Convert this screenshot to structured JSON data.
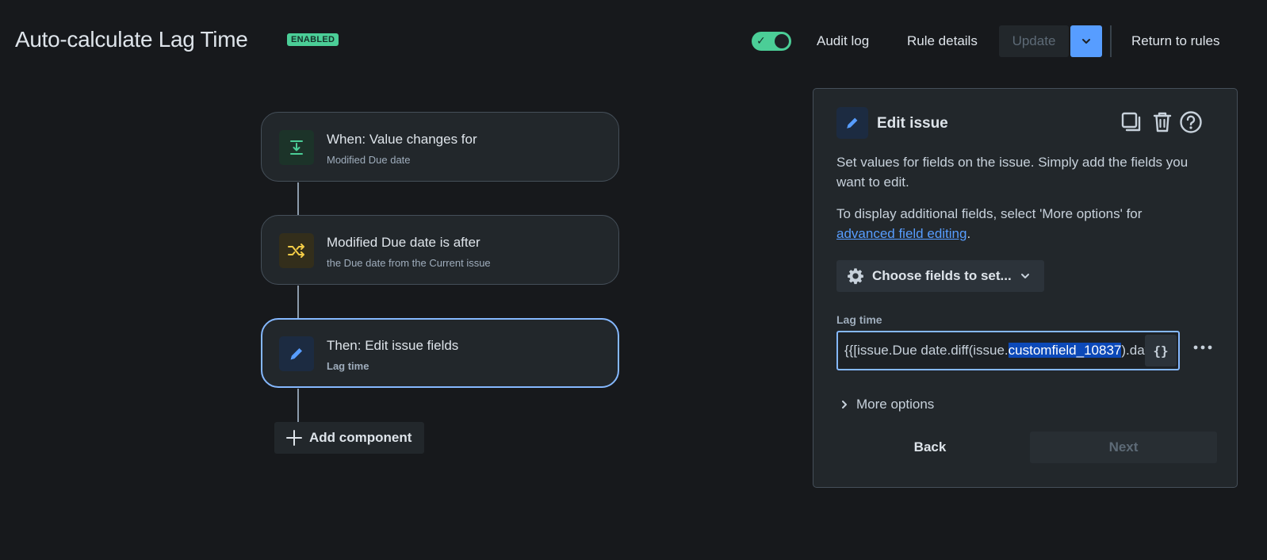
{
  "header": {
    "title": "Auto-calculate Lag Time",
    "status_badge": "ENABLED",
    "audit_log": "Audit log",
    "rule_details": "Rule details",
    "update": "Update",
    "return_to_rules": "Return to rules"
  },
  "flow": {
    "trigger": {
      "title": "When: Value changes for",
      "subtitle": "Modified Due date"
    },
    "condition": {
      "title": "Modified Due date is after",
      "subtitle": "the Due date from the Current issue"
    },
    "action": {
      "title": "Then: Edit issue fields",
      "subtitle": "Lag time"
    },
    "add_component": "Add component"
  },
  "panel": {
    "title": "Edit issue",
    "desc1": "Set values for fields on the issue. Simply add the fields you want to edit.",
    "desc2_prefix": "To display additional fields, select 'More options' for",
    "desc2_link": "advanced field editing",
    "desc2_suffix": ".",
    "choose_fields": "Choose fields to set...",
    "field_label": "Lag time",
    "field_value_before": "{{[issue.Due date.diff(issue.",
    "field_value_highlight": "customfield_10837",
    "field_value_after": ").days",
    "braces": "{}",
    "more_options": "More options",
    "back": "Back",
    "next": "Next"
  },
  "colors": {
    "accent": "#579dff",
    "enabled_green": "#4bce97",
    "background": "#17191c",
    "card": "#22272b"
  },
  "icons": {
    "trigger": "download-arrow-icon",
    "condition": "shuffle-icon",
    "action": "pencil-icon",
    "copy": "copy-icon",
    "delete": "trash-icon",
    "help": "question-icon",
    "settings": "gear-icon"
  }
}
